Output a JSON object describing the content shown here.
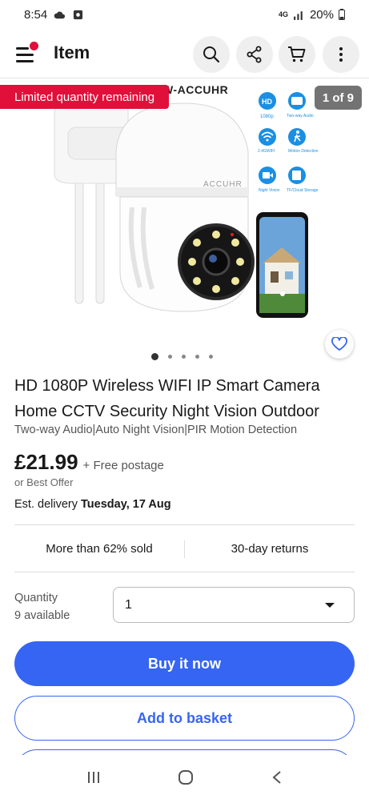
{
  "status_bar": {
    "time": "8:54",
    "network": "4G",
    "battery": "20%"
  },
  "header": {
    "title": "Item"
  },
  "gallery": {
    "limited_badge": "Limited quantity remaining",
    "counter": "1 of 9",
    "brand_text": "W-ACCUHR",
    "camera_brand": "ACCUHR",
    "features": [
      "1080p",
      "Two-way Audio",
      "2.4GWIFI",
      "Motion Detection",
      "Night Vision",
      "TF/Cloud Storage"
    ],
    "hd_label": "HD"
  },
  "product": {
    "title": "HD 1080P Wireless WIFI IP Smart Camera Home CCTV Security Night Vision Outdoor",
    "subtitle": "Two-way Audio|Auto Night Vision|PIR Motion Detection",
    "price": "£21.99",
    "postage": "+ Free postage",
    "best_offer": "or Best Offer",
    "delivery_prefix": "Est. delivery",
    "delivery_date": "Tuesday, 17 Aug",
    "sold": "More than 62% sold",
    "returns": "30-day returns"
  },
  "quantity": {
    "label": "Quantity",
    "available": "9 available",
    "value": "1"
  },
  "actions": {
    "buy_now": "Buy it now",
    "add_to_basket": "Add to basket"
  },
  "colors": {
    "accent_blue": "#3665f3",
    "badge_red": "#e0103a"
  }
}
